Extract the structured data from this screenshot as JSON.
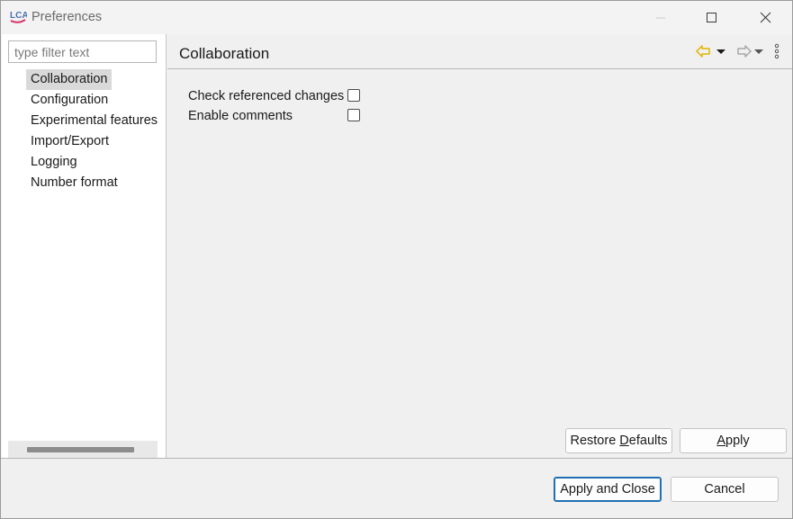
{
  "window": {
    "title": "Preferences",
    "app_icon_text": "LCA",
    "controls": {
      "minimize": "minimize-icon",
      "maximize": "maximize-icon",
      "close": "close-icon"
    }
  },
  "sidebar": {
    "filter_placeholder": "type filter text",
    "filter_value": "",
    "items": [
      {
        "label": "Collaboration",
        "selected": true
      },
      {
        "label": "Configuration",
        "selected": false
      },
      {
        "label": "Experimental features",
        "selected": false
      },
      {
        "label": "Import/Export",
        "selected": false
      },
      {
        "label": "Logging",
        "selected": false
      },
      {
        "label": "Number format",
        "selected": false
      }
    ]
  },
  "page": {
    "title": "Collaboration",
    "options": [
      {
        "label": "Check referenced changes",
        "checked": false
      },
      {
        "label": "Enable comments",
        "checked": false
      }
    ],
    "restore_defaults_prefix": "Restore ",
    "restore_defaults_mnemonic": "D",
    "restore_defaults_suffix": "efaults",
    "apply_mnemonic": "A",
    "apply_suffix": "pply"
  },
  "footer": {
    "apply_close_label": "Apply and Close",
    "cancel_label": "Cancel"
  },
  "colors": {
    "back_arrow": "#e0b400",
    "forward_arrow": "#a8a8a8",
    "selection": "#d9d9d9",
    "default_button_border": "#1f6fb2"
  }
}
